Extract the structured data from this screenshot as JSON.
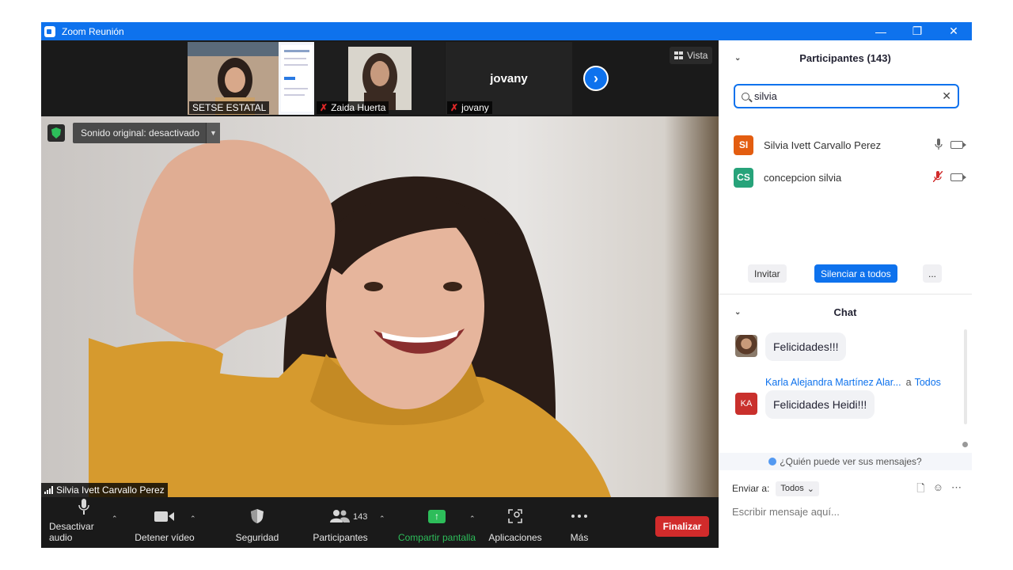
{
  "window": {
    "title": "Zoom Reunión",
    "min": "—",
    "restore": "❐",
    "close": "✕"
  },
  "strip": {
    "thumbs": [
      {
        "label": "SETSE ESTATAL",
        "muted": false
      },
      {
        "label": "Zaida Huerta",
        "muted": true
      },
      {
        "label": "jovany",
        "muted": true,
        "big_name": "jovany"
      }
    ],
    "next": "›",
    "view_label": "Vista"
  },
  "main": {
    "sound_label": "Sonido original: desactivado",
    "sound_caret": "▼",
    "speaker_name": "Silvia Ivett Carvallo Perez"
  },
  "toolbar": {
    "mute_label": "Desactivar audio",
    "video_label": "Detener vídeo",
    "security_label": "Seguridad",
    "participants_label": "Participantes",
    "participants_count": "143",
    "share_label": "Compartir pantalla",
    "apps_label": "Aplicaciones",
    "more_label": "Más",
    "end_label": "Finalizar",
    "caret": "⌃"
  },
  "participants": {
    "title": "Participantes (143)",
    "search_value": "silvia",
    "list": [
      {
        "initials": "SI",
        "name": "Silvia Ivett Carvallo Perez",
        "color": "#e35d10",
        "mic_muted": false
      },
      {
        "initials": "CS",
        "name": "concepcion silvia",
        "color": "#27a37a",
        "mic_muted": true
      }
    ],
    "invite_label": "Invitar",
    "mute_all_label": "Silenciar a todos",
    "more_label": "..."
  },
  "chat": {
    "title": "Chat",
    "messages": [
      {
        "text": "Felicidades!!!"
      },
      {
        "sender": "Karla Alejandra Martínez Alar...",
        "to": "a",
        "to_who": "Todos",
        "initials": "KA",
        "text": "Felicidades Heidi!!!"
      }
    ],
    "who_sees": "¿Quién puede ver sus mensajes?",
    "send_to_label": "Enviar a:",
    "send_to_value": "Todos",
    "input_placeholder": "Escribir mensaje aquí..."
  },
  "colors": {
    "zoom_blue": "#0e72ed",
    "share_green": "#2dbd5a",
    "end_red": "#d12b2b"
  }
}
